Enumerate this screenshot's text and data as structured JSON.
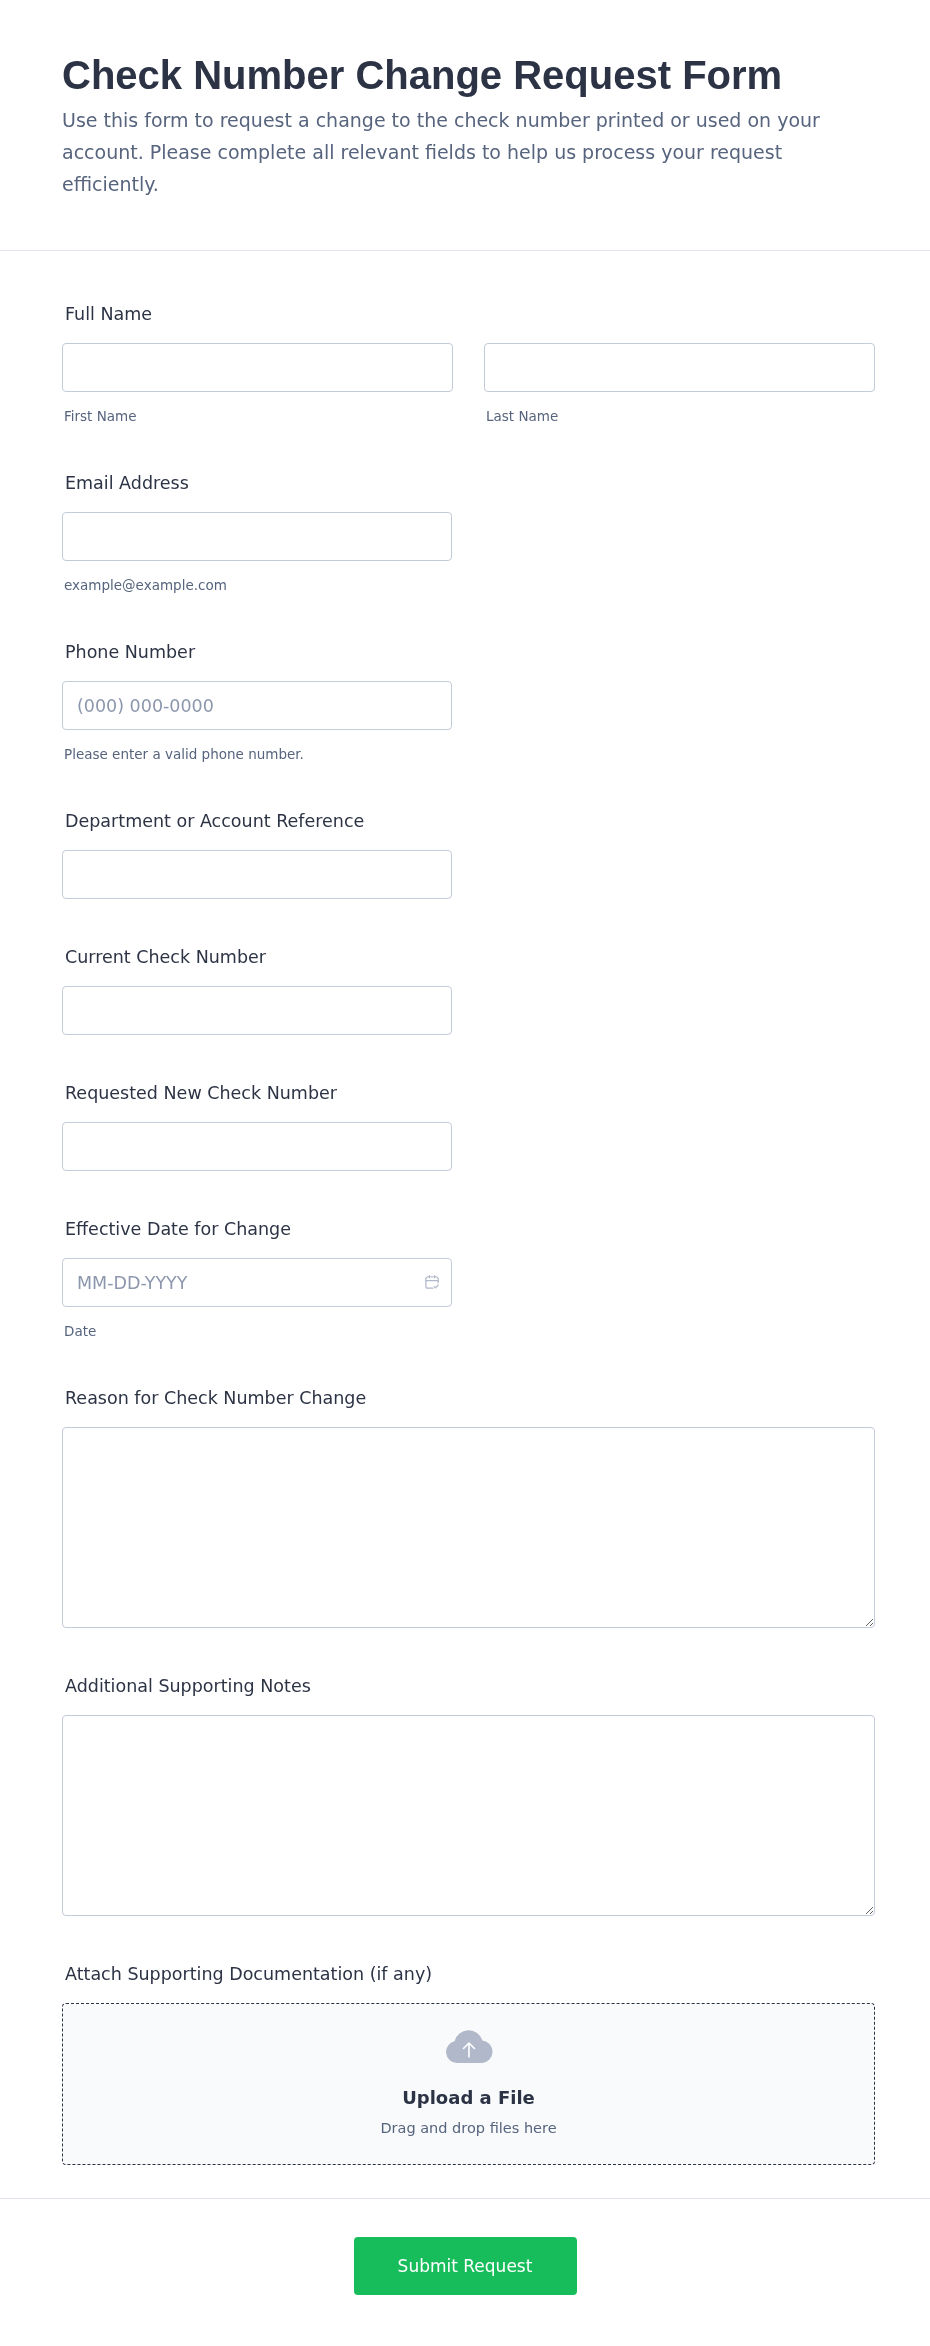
{
  "header": {
    "title": "Check Number Change Request Form",
    "description": "Use this form to request a change to the check number printed or used on your account. Please complete all relevant fields to help us process your request efficiently."
  },
  "fields": [
    {
      "kind": "name",
      "label": "Full Name",
      "inputs": [
        {
          "sublabel": "First Name"
        },
        {
          "sublabel": "Last Name"
        }
      ]
    },
    {
      "kind": "text",
      "label": "Email Address",
      "hint": "example@example.com"
    },
    {
      "kind": "text",
      "label": "Phone Number",
      "placeholder": "(000) 000-0000",
      "hint": "Please enter a valid phone number."
    },
    {
      "kind": "text",
      "label": "Department or Account Reference"
    },
    {
      "kind": "text",
      "label": "Current Check Number"
    },
    {
      "kind": "text",
      "label": "Requested New Check Number"
    },
    {
      "kind": "date",
      "label": "Effective Date for Change",
      "placeholder": "MM-DD-YYYY",
      "hint": "Date"
    },
    {
      "kind": "textarea",
      "label": "Reason for Check Number Change"
    },
    {
      "kind": "textarea",
      "label": "Additional Supporting Notes"
    },
    {
      "kind": "upload",
      "label": "Attach Supporting Documentation (if any)",
      "title": "Upload a File",
      "subtitle": "Drag and drop files here"
    }
  ],
  "submit": {
    "label": "Submit Request"
  }
}
